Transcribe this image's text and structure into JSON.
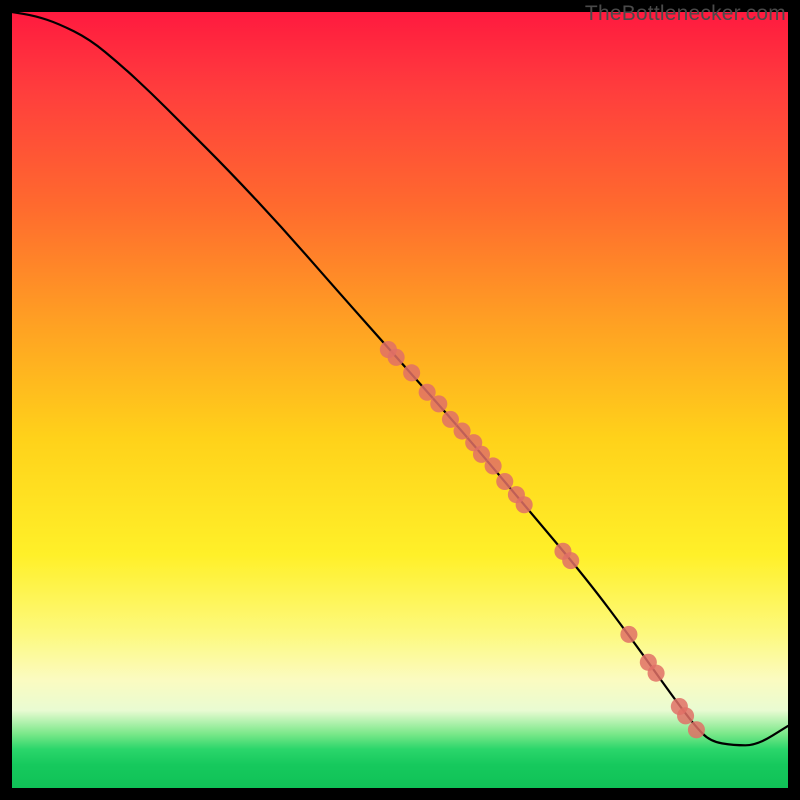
{
  "watermark": "TheBottleneсker.com",
  "colors": {
    "frame": "#000000",
    "curve": "#000000",
    "marker_fill": "#e07066",
    "marker_stroke": "#c95a52"
  },
  "chart_data": {
    "type": "line",
    "title": "",
    "xlabel": "",
    "ylabel": "",
    "xlim": [
      0,
      100
    ],
    "ylim": [
      0,
      100
    ],
    "grid": false,
    "legend": false,
    "series": [
      {
        "name": "curve",
        "x": [
          0,
          3,
          6,
          10,
          14,
          18,
          22,
          28,
          35,
          42,
          50,
          58,
          66,
          74,
          80,
          85,
          88,
          90,
          93,
          96,
          100
        ],
        "y": [
          100,
          99.5,
          98.5,
          96.5,
          93.2,
          89.5,
          85.5,
          79.5,
          72,
          64,
          55,
          46,
          36.5,
          27,
          19,
          12,
          8,
          6,
          5.5,
          5.5,
          8
        ]
      }
    ],
    "markers": [
      {
        "x": 48.5,
        "y": 56.5
      },
      {
        "x": 49.5,
        "y": 55.5
      },
      {
        "x": 51.5,
        "y": 53.5
      },
      {
        "x": 53.5,
        "y": 51
      },
      {
        "x": 55.0,
        "y": 49.5
      },
      {
        "x": 56.5,
        "y": 47.5
      },
      {
        "x": 58.0,
        "y": 46
      },
      {
        "x": 59.5,
        "y": 44.5
      },
      {
        "x": 60.5,
        "y": 43
      },
      {
        "x": 62.0,
        "y": 41.5
      },
      {
        "x": 63.5,
        "y": 39.5
      },
      {
        "x": 65.0,
        "y": 37.8
      },
      {
        "x": 66.0,
        "y": 36.5
      },
      {
        "x": 71.0,
        "y": 30.5
      },
      {
        "x": 72.0,
        "y": 29.3
      },
      {
        "x": 79.5,
        "y": 19.8
      },
      {
        "x": 82.0,
        "y": 16.2
      },
      {
        "x": 83.0,
        "y": 14.8
      },
      {
        "x": 86.0,
        "y": 10.5
      },
      {
        "x": 86.8,
        "y": 9.3
      },
      {
        "x": 88.2,
        "y": 7.5
      }
    ],
    "marker_radius": 1.1
  }
}
